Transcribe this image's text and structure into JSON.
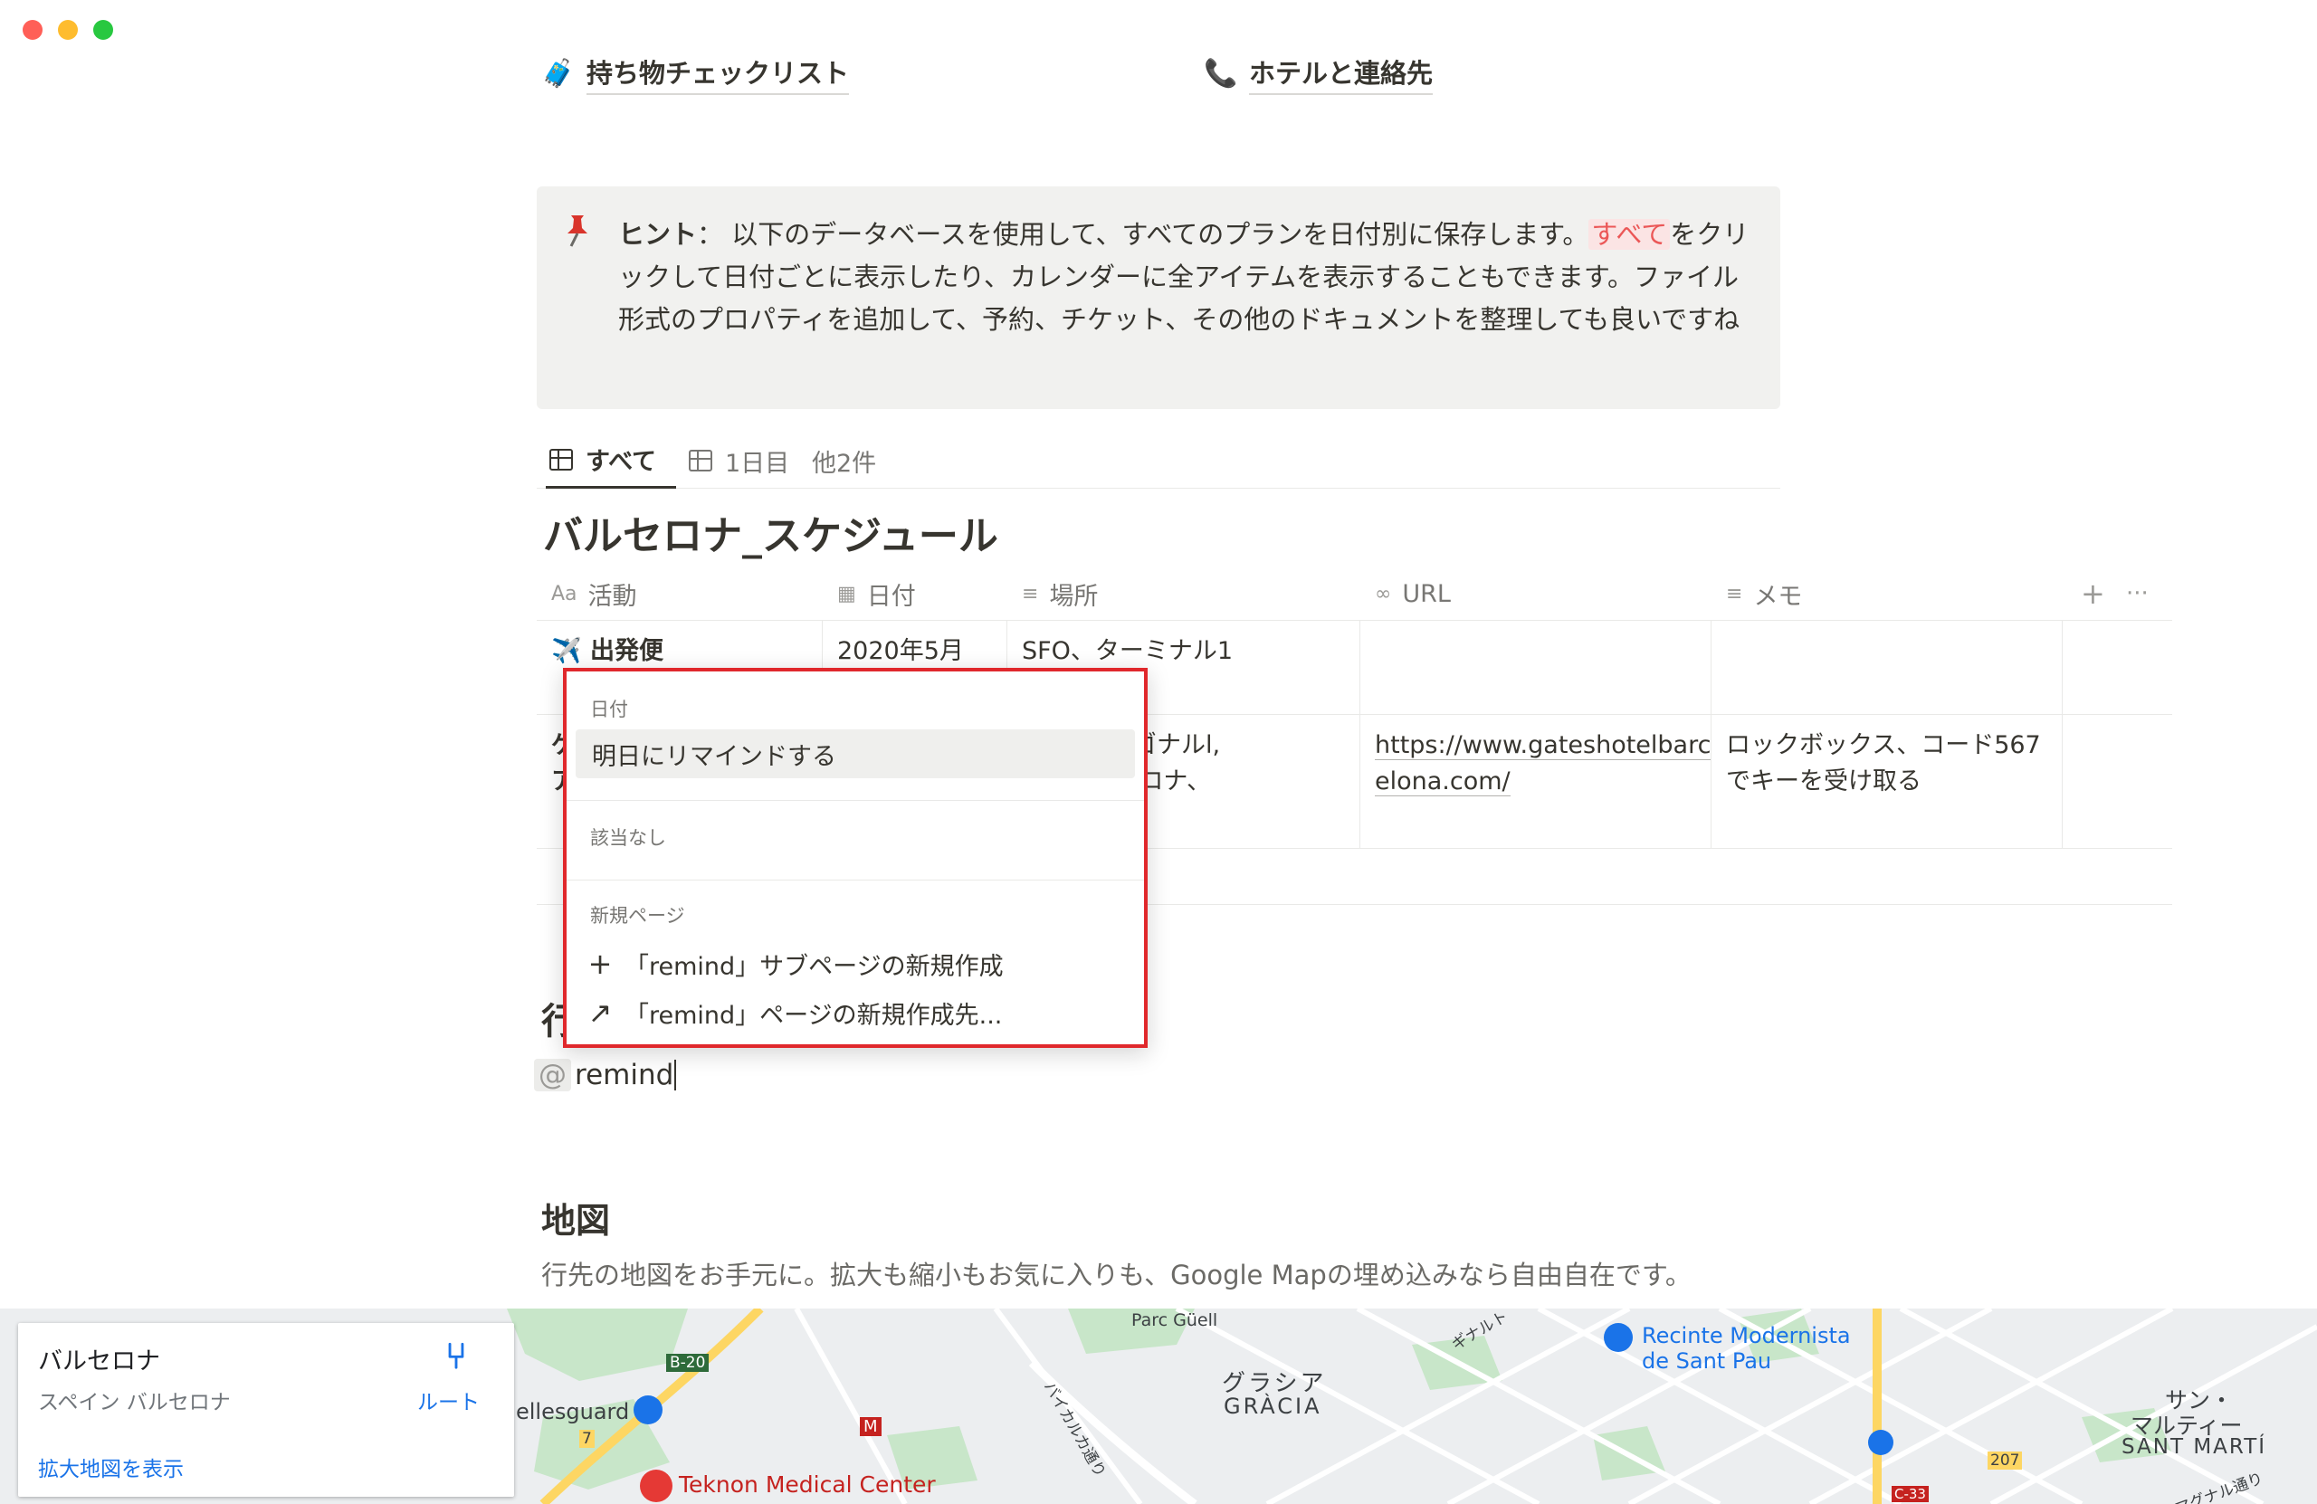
{
  "window": {
    "controls": [
      "close",
      "minimize",
      "zoom"
    ]
  },
  "top_links": [
    {
      "icon": "🧳",
      "label": "持ち物チェックリスト"
    },
    {
      "icon": "📞",
      "label": "ホテルと連絡先"
    }
  ],
  "callout": {
    "icon": "pushpin-icon",
    "bold_label": "ヒント",
    "text_before": "： 以下のデータベースを使用して、すべてのプランを日付別に保存します。",
    "highlight": "すべて",
    "text_after": "をクリックして日付ごとに表示したり、カレンダーに全アイテムを表示することもできます。ファイル形式のプロパティを追加して、予約、チケット、その他のドキュメントを整理しても良いですね"
  },
  "tabs": [
    {
      "label": "すべて",
      "active": true
    },
    {
      "label": "1日目",
      "active": false
    },
    {
      "label": "他2件",
      "active": false
    }
  ],
  "database": {
    "title": "バルセロナ_スケジュール",
    "columns": [
      {
        "icon": "Aa",
        "label": "活動"
      },
      {
        "icon": "▦",
        "label": "日付"
      },
      {
        "icon": "≡",
        "label": "場所"
      },
      {
        "icon": "∞",
        "label": "URL"
      },
      {
        "icon": "≡",
        "label": "メモ"
      }
    ],
    "add_column": "+",
    "more": "···",
    "rows": [
      {
        "activity": "✈️ 出発便",
        "date": "2020年5月30",
        "place": "SFO、ターミナル1",
        "url": "",
        "memo": ""
      },
      {
        "activity": "ゲ",
        "activity2": "ア",
        "date": "",
        "place": "ダダイアゴナルl,",
        "place2": "18バルセロナ、",
        "url": "https://www.gateshotelbarc",
        "url2": "elona.com/",
        "memo": "ロックボックス、コード567",
        "memo2": "でキーを受け取る"
      }
    ]
  },
  "popup": {
    "section_date": "日付",
    "remind_tomorrow": "明日にリマインドする",
    "section_none": "該当なし",
    "section_new_page": "新規ページ",
    "create_subpage": "「remind」サブページの新規作成",
    "create_page_in": "「remind」ページの新規作成先..."
  },
  "editor": {
    "clipped_heading": "行",
    "mention_symbol": "@",
    "mention_text": "remind"
  },
  "map_section": {
    "heading": "地図",
    "description": "行先の地図をお手元に。拡大も縮小もお気に入りも、Google Mapの埋め込みなら自由自在です。"
  },
  "map": {
    "card": {
      "name": "バルセロナ",
      "subtitle": "スペイン バルセロナ",
      "route": "ルート",
      "larger_map": "拡大地図を表示"
    },
    "labels": {
      "parc_guell": "Parc Güell",
      "gracia_jp": "グラシア",
      "gracia": "GRÀCIA",
      "recinte1": "Recinte Modernista",
      "recinte2": "de Sant Pau",
      "sant_marti_jp1": "サン・",
      "sant_marti_jp2": "マルティー",
      "sant_marti": "SANT MARTÍ",
      "teknon": "Teknon Medical Center",
      "bellesguard": "ellesguard",
      "b20": "B-20",
      "road_7": "7",
      "road_207": "207",
      "c33": "C-33",
      "metro": "M",
      "diagonal_jp": "ギナルト",
      "avinguda_jp": "バイカルカ通り",
      "street_jp": "マグナル通り"
    },
    "colors": {
      "park": "#c8e6c9",
      "road": "#ffffff",
      "highway": "#fdd663",
      "water": "#aadaff"
    }
  }
}
